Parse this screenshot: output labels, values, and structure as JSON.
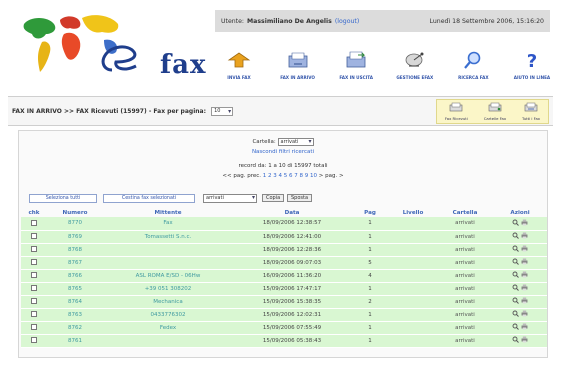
{
  "logo": {
    "text": "fax"
  },
  "user_bar": {
    "prefix": "Utente:",
    "name": "Massimiliano De Angelis",
    "logout": "(logout)",
    "date": "Lunedì 18 Settembre 2006, 15:16:20"
  },
  "toolbar": [
    {
      "label": "INVIA FAX",
      "icon": "send-fax-icon",
      "color": "#e9a21f"
    },
    {
      "label": "FAX IN ARRIVO",
      "icon": "incoming-fax-icon",
      "color": "#5577cc"
    },
    {
      "label": "FAX IN USCITA",
      "icon": "outgoing-fax-icon",
      "color": "#5577cc"
    },
    {
      "label": "GESTIONE EFAX",
      "icon": "satellite-icon",
      "color": "#777777"
    },
    {
      "label": "RICERCA FAX",
      "icon": "search-icon",
      "color": "#3b6fd0"
    },
    {
      "label": "AIUTO IN LINEA",
      "icon": "help-icon",
      "color": "#2d55c8"
    }
  ],
  "breadcrumb": {
    "text": "FAX IN ARRIVO >> FAX Ricevuti (15997) - Fax per pagina:",
    "per_page": "10"
  },
  "mini_tools": [
    {
      "label": "Fax Ricevuti",
      "icon": "fax-received-icon"
    },
    {
      "label": "Cartelle Fax",
      "icon": "fax-folders-icon"
    },
    {
      "label": "Tutti i Fax",
      "icon": "all-fax-icon"
    }
  ],
  "filters": {
    "folder_label": "Cartella:",
    "folder_value": "arrivati",
    "hide_filters": "Nascondi filtri ricercati",
    "record_info": "record da: 1 a 10 di 15997 totali",
    "pager_prev": "<< pag. prec.",
    "pager_pages": "1 2 3 4 5 6 7 8 9 10",
    "pager_next": "> pag. >"
  },
  "actions": {
    "select_all": "Seleziona tutti",
    "delete_selected": "Cestina fax selezionati",
    "move_value": "arrivati",
    "copy": "Copia",
    "move": "Sposta"
  },
  "table": {
    "headers": [
      "chk",
      "Numero",
      "Mittente",
      "Data",
      "Pag",
      "Livello",
      "Cartella",
      "Azioni"
    ],
    "rows": [
      {
        "numero": "8770",
        "mittente": "Fax",
        "data": "18/09/2006 12:38:57",
        "pag": "1",
        "livello": "",
        "cartella": "arrivati"
      },
      {
        "numero": "8769",
        "mittente": "Tomassetti S.n.c.",
        "data": "18/09/2006 12:41:00",
        "pag": "1",
        "livello": "",
        "cartella": "arrivati"
      },
      {
        "numero": "8768",
        "mittente": "",
        "data": "18/09/2006 12:28:36",
        "pag": "1",
        "livello": "",
        "cartella": "arrivati"
      },
      {
        "numero": "8767",
        "mittente": "",
        "data": "18/09/2006 09:07:03",
        "pag": "5",
        "livello": "",
        "cartella": "arrivati"
      },
      {
        "numero": "8766",
        "mittente": "ASL ROMA E/SD - 06Hw",
        "data": "16/09/2006 11:36:20",
        "pag": "4",
        "livello": "",
        "cartella": "arrivati"
      },
      {
        "numero": "8765",
        "mittente": "+39 051 308202",
        "data": "15/09/2006 17:47:17",
        "pag": "1",
        "livello": "",
        "cartella": "arrivati"
      },
      {
        "numero": "8764",
        "mittente": "Mechanica",
        "data": "15/09/2006 15:38:35",
        "pag": "2",
        "livello": "",
        "cartella": "arrivati"
      },
      {
        "numero": "8763",
        "mittente": "0433776302",
        "data": "15/09/2006 12:02:31",
        "pag": "1",
        "livello": "",
        "cartella": "arrivati"
      },
      {
        "numero": "8762",
        "mittente": "Fedex",
        "data": "15/09/2006 07:55:49",
        "pag": "1",
        "livello": "",
        "cartella": "arrivati"
      },
      {
        "numero": "8761",
        "mittente": "",
        "data": "15/09/2006 05:38:43",
        "pag": "1",
        "livello": "",
        "cartella": "arrivati"
      }
    ]
  }
}
